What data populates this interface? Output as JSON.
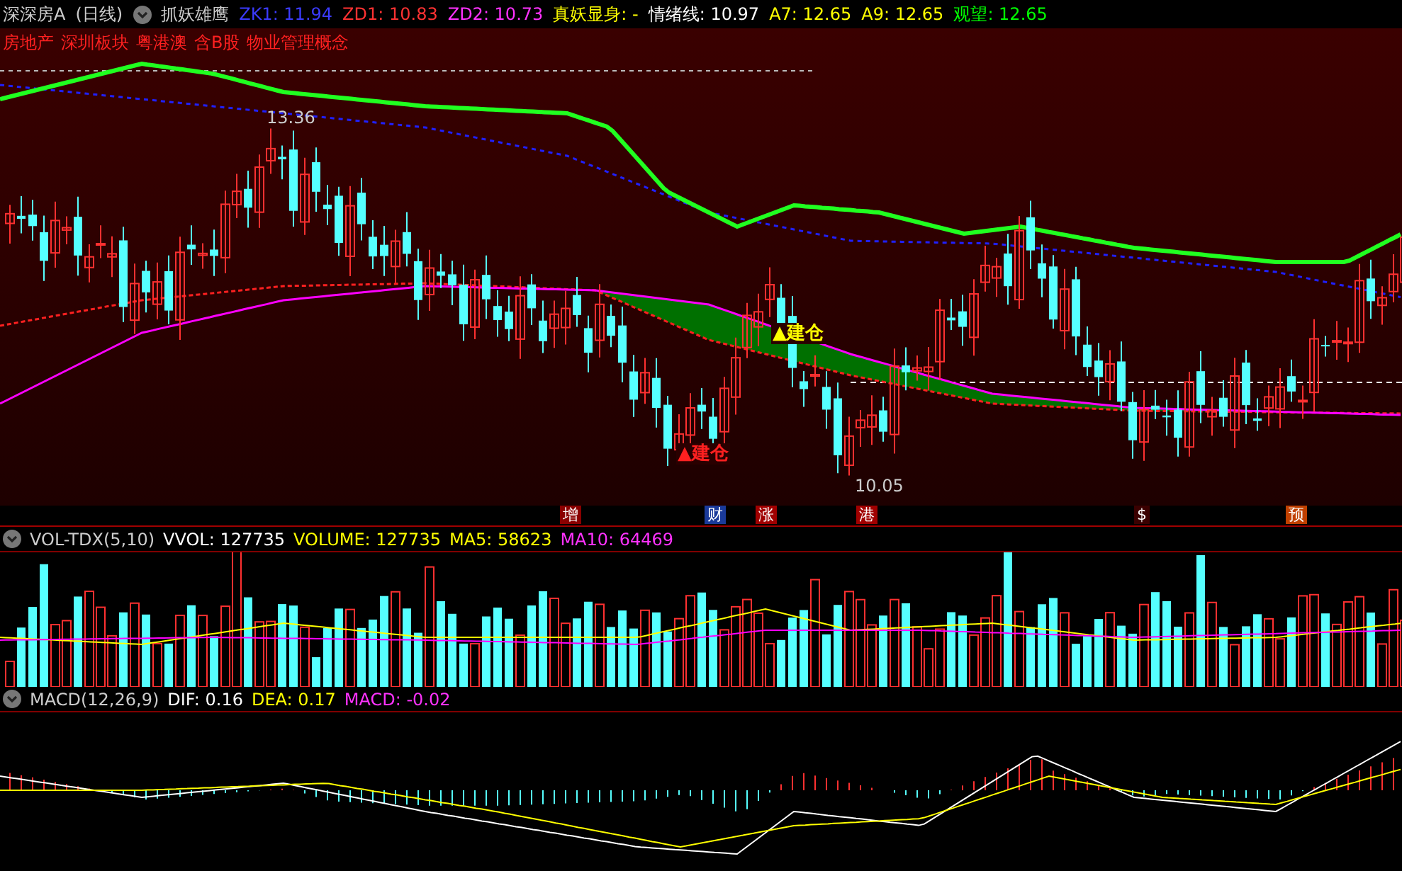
{
  "header": {
    "stock": "深深房A",
    "period": "(日线)",
    "indicator": "抓妖雄鹰",
    "values": [
      {
        "text": "ZK1: 11.94",
        "color": "#3b3bff"
      },
      {
        "text": "ZD1: 10.83",
        "color": "#ff3232"
      },
      {
        "text": "ZD2: 10.73",
        "color": "#ff32ff"
      },
      {
        "text": "真妖显身: -",
        "color": "#ffff00"
      },
      {
        "text": "情绪线: 10.97",
        "color": "#ffffff"
      },
      {
        "text": "A7: 12.65",
        "color": "#ffff00"
      },
      {
        "text": "A9: 12.65",
        "color": "#ffff00"
      },
      {
        "text": "观望: 12.65",
        "color": "#00ff00"
      }
    ]
  },
  "sectors": [
    "房地产",
    "深圳板块",
    "粤港澳",
    "含B股",
    "物业管理概念"
  ],
  "price_labels": [
    "13.36",
    "10.05"
  ],
  "signals": [
    {
      "text": "▲建仓",
      "kind": "low"
    },
    {
      "text": "▲建仓",
      "kind": "breakout"
    }
  ],
  "events": [
    {
      "text": "增",
      "color": "#8a0000"
    },
    {
      "text": "财",
      "color": "#1a3a9a"
    },
    {
      "text": "涨",
      "color": "#a00000"
    },
    {
      "text": "港",
      "color": "#a00000"
    },
    {
      "text": "$",
      "color": "#3a0000"
    },
    {
      "text": "预",
      "color": "#c04000"
    }
  ],
  "volume": {
    "name": "VOL-TDX(5,10)",
    "values": [
      {
        "text": "VVOL: 127735",
        "color": "#ffffff"
      },
      {
        "text": "VOLUME: 127735",
        "color": "#ffff00"
      },
      {
        "text": "MA5: 58623",
        "color": "#ffff00"
      },
      {
        "text": "MA10: 64469",
        "color": "#ff32ff"
      }
    ]
  },
  "macd": {
    "name": "MACD(12,26,9)",
    "values": [
      {
        "text": "DIF: 0.16",
        "color": "#ffffff"
      },
      {
        "text": "DEA: 0.17",
        "color": "#ffff00"
      },
      {
        "text": "MACD: -0.02",
        "color": "#ff32ff"
      }
    ]
  }
}
